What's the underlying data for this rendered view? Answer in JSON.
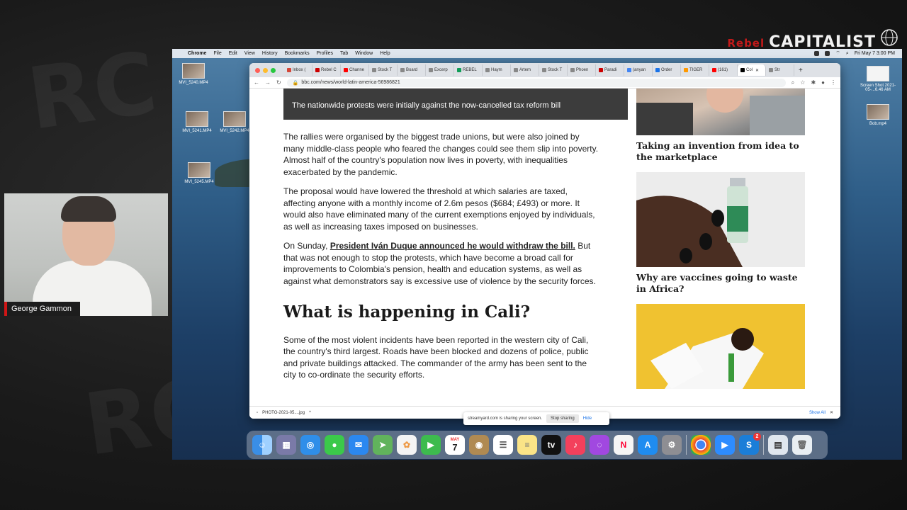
{
  "brand": {
    "word1": "Rebel",
    "word2": "CAPITALIST"
  },
  "menubar": {
    "items": [
      "Chrome",
      "File",
      "Edit",
      "View",
      "History",
      "Bookmarks",
      "Profiles",
      "Tab",
      "Window",
      "Help"
    ],
    "clock": "Fri May 7  3:00 PM"
  },
  "desktop": {
    "icons": [
      "MVI_5240.MP4",
      "MVI_5241.MP4",
      "MVI_5242.MP4",
      "MVI_5245.MP4",
      "Screen Shot 2021-05-...6.46 AM",
      "Bob.mp4"
    ]
  },
  "browser": {
    "tabs": [
      "Inbox (",
      "Rebel C",
      "Channe",
      "Stock T",
      "Board",
      "Excerp",
      "REBEL",
      "Haym",
      "Artem",
      "Stock T",
      "Phoen",
      "Paradi",
      "(anyan",
      "Order",
      "TIGER",
      "(161)",
      "Col",
      "Str"
    ],
    "url": "bbc.com/news/world-latin-america-56986821",
    "download_file": "PHOTO-2021-05....jpg",
    "show_all": "Show All",
    "share_text": "streamyard.com is sharing your screen.",
    "stop_sharing": "Stop sharing",
    "hide": "Hide"
  },
  "article": {
    "caption": "The nationwide protests were initially against the now-cancelled tax reform bill",
    "p1": "The rallies were organised by the biggest trade unions, but were also joined by many middle-class people who feared the changes could see them slip into poverty. Almost half of the country's population now lives in poverty, with inequalities exacerbated by the pandemic.",
    "p2": "The proposal would have lowered the threshold at which salaries are taxed, affecting anyone with a monthly income of 2.6m pesos ($684; £493) or more. It would also have eliminated many of the current exemptions enjoyed by individuals, as well as increasing taxes imposed on businesses.",
    "p3_pre": "On Sunday, ",
    "p3_link": "President Iván Duque announced he would withdraw the bill.",
    "p3_post": " But that was not enough to stop the protests, which have become a broad call for improvements to Colombia's pension, health and education systems, as well as against what demonstrators say is excessive use of violence by the security forces.",
    "heading": "What is happening in Cali?",
    "p4": "Some of the most violent incidents have been reported in the western city of Cali, the country's third largest. Roads have been blocked and dozens of police, public and private buildings attacked. The commander of the army has been sent to the city to co-ordinate the security efforts."
  },
  "sidebar": {
    "story1": "Taking an invention from idea to the marketplace",
    "story2": "Why are vaccines going to waste in Africa?"
  },
  "webcam": {
    "name": "George Gammon"
  },
  "dock": {
    "calendar_month": "MAY",
    "calendar_day": "7",
    "badge": "2"
  },
  "colors": {
    "brand_red": "#c21a1a",
    "name_red": "#d01616",
    "caption_bg": "#3c3c3c"
  }
}
